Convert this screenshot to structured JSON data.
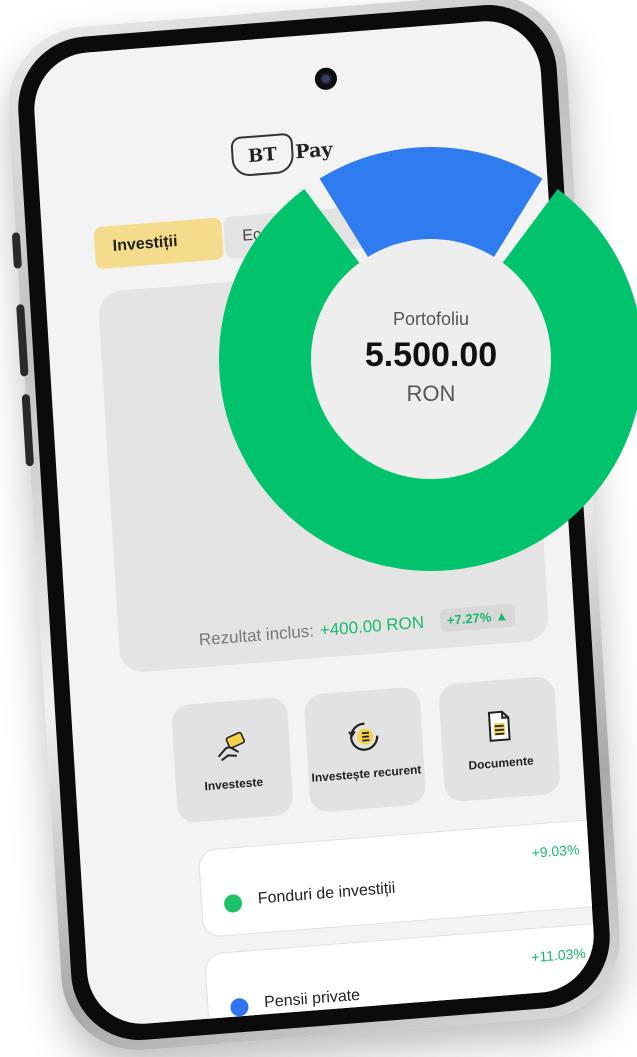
{
  "app": {
    "logo_text": "BTPay",
    "logo_bt": "BT",
    "logo_pay": "Pay"
  },
  "tabs": [
    {
      "label": "Investiții",
      "active": true
    },
    {
      "label": "Econo",
      "active": false
    }
  ],
  "summary": {
    "result_label": "Rezultat inclus:",
    "result_value": "+400.00 RON",
    "result_percent": "+7.27%",
    "trend_icon": "triangle-up-icon"
  },
  "actions": [
    {
      "label": "Investeste",
      "icon": "hand-money-icon"
    },
    {
      "label": "Investește recurent",
      "icon": "recurring-list-icon"
    },
    {
      "label": "Documente",
      "icon": "document-icon"
    }
  ],
  "products": [
    {
      "name": "Fonduri de investiții",
      "change": "+9.03%",
      "color": "#1ec165"
    },
    {
      "name": "Pensii private",
      "change": "+11.03%",
      "color": "#2f74f0"
    }
  ],
  "portfolio": {
    "label": "Portofoliu",
    "amount": "5.500.00",
    "currency": "RON"
  },
  "chart_data": {
    "type": "pie",
    "categories": [
      "Fonduri de investiții",
      "Pensii private"
    ],
    "values": [
      81,
      19
    ],
    "colors": [
      "#00c36b",
      "#2f7bf0"
    ],
    "title": ""
  },
  "colors": {
    "accent_yellow": "#f4dc8c",
    "positive_green": "#19b86c",
    "donut_green": "#00c36b",
    "donut_blue": "#2f7bf0"
  }
}
